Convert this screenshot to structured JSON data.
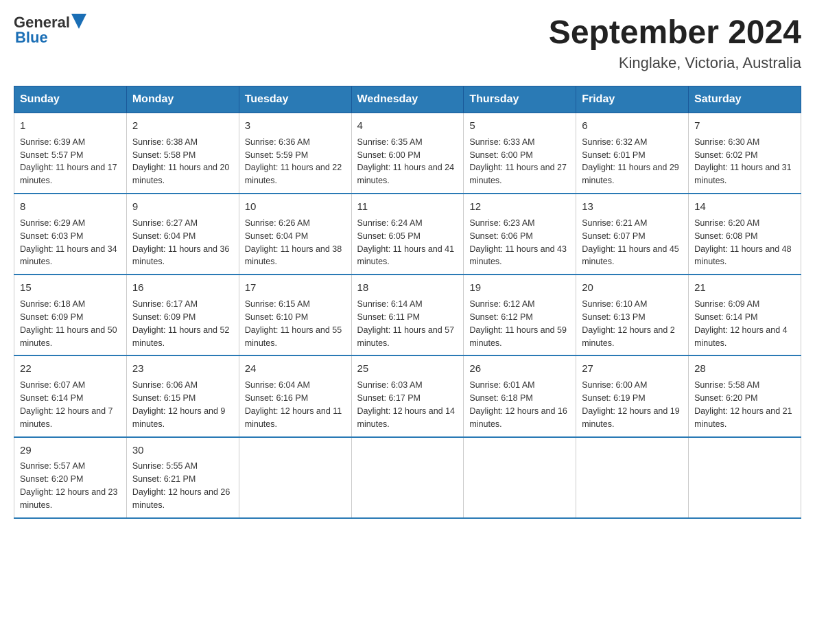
{
  "header": {
    "logo_text_general": "General",
    "logo_text_blue": "Blue",
    "main_title": "September 2024",
    "subtitle": "Kinglake, Victoria, Australia"
  },
  "days_of_week": [
    "Sunday",
    "Monday",
    "Tuesday",
    "Wednesday",
    "Thursday",
    "Friday",
    "Saturday"
  ],
  "weeks": [
    [
      {
        "day": "1",
        "sunrise": "6:39 AM",
        "sunset": "5:57 PM",
        "daylight": "11 hours and 17 minutes."
      },
      {
        "day": "2",
        "sunrise": "6:38 AM",
        "sunset": "5:58 PM",
        "daylight": "11 hours and 20 minutes."
      },
      {
        "day": "3",
        "sunrise": "6:36 AM",
        "sunset": "5:59 PM",
        "daylight": "11 hours and 22 minutes."
      },
      {
        "day": "4",
        "sunrise": "6:35 AM",
        "sunset": "6:00 PM",
        "daylight": "11 hours and 24 minutes."
      },
      {
        "day": "5",
        "sunrise": "6:33 AM",
        "sunset": "6:00 PM",
        "daylight": "11 hours and 27 minutes."
      },
      {
        "day": "6",
        "sunrise": "6:32 AM",
        "sunset": "6:01 PM",
        "daylight": "11 hours and 29 minutes."
      },
      {
        "day": "7",
        "sunrise": "6:30 AM",
        "sunset": "6:02 PM",
        "daylight": "11 hours and 31 minutes."
      }
    ],
    [
      {
        "day": "8",
        "sunrise": "6:29 AM",
        "sunset": "6:03 PM",
        "daylight": "11 hours and 34 minutes."
      },
      {
        "day": "9",
        "sunrise": "6:27 AM",
        "sunset": "6:04 PM",
        "daylight": "11 hours and 36 minutes."
      },
      {
        "day": "10",
        "sunrise": "6:26 AM",
        "sunset": "6:04 PM",
        "daylight": "11 hours and 38 minutes."
      },
      {
        "day": "11",
        "sunrise": "6:24 AM",
        "sunset": "6:05 PM",
        "daylight": "11 hours and 41 minutes."
      },
      {
        "day": "12",
        "sunrise": "6:23 AM",
        "sunset": "6:06 PM",
        "daylight": "11 hours and 43 minutes."
      },
      {
        "day": "13",
        "sunrise": "6:21 AM",
        "sunset": "6:07 PM",
        "daylight": "11 hours and 45 minutes."
      },
      {
        "day": "14",
        "sunrise": "6:20 AM",
        "sunset": "6:08 PM",
        "daylight": "11 hours and 48 minutes."
      }
    ],
    [
      {
        "day": "15",
        "sunrise": "6:18 AM",
        "sunset": "6:09 PM",
        "daylight": "11 hours and 50 minutes."
      },
      {
        "day": "16",
        "sunrise": "6:17 AM",
        "sunset": "6:09 PM",
        "daylight": "11 hours and 52 minutes."
      },
      {
        "day": "17",
        "sunrise": "6:15 AM",
        "sunset": "6:10 PM",
        "daylight": "11 hours and 55 minutes."
      },
      {
        "day": "18",
        "sunrise": "6:14 AM",
        "sunset": "6:11 PM",
        "daylight": "11 hours and 57 minutes."
      },
      {
        "day": "19",
        "sunrise": "6:12 AM",
        "sunset": "6:12 PM",
        "daylight": "11 hours and 59 minutes."
      },
      {
        "day": "20",
        "sunrise": "6:10 AM",
        "sunset": "6:13 PM",
        "daylight": "12 hours and 2 minutes."
      },
      {
        "day": "21",
        "sunrise": "6:09 AM",
        "sunset": "6:14 PM",
        "daylight": "12 hours and 4 minutes."
      }
    ],
    [
      {
        "day": "22",
        "sunrise": "6:07 AM",
        "sunset": "6:14 PM",
        "daylight": "12 hours and 7 minutes."
      },
      {
        "day": "23",
        "sunrise": "6:06 AM",
        "sunset": "6:15 PM",
        "daylight": "12 hours and 9 minutes."
      },
      {
        "day": "24",
        "sunrise": "6:04 AM",
        "sunset": "6:16 PM",
        "daylight": "12 hours and 11 minutes."
      },
      {
        "day": "25",
        "sunrise": "6:03 AM",
        "sunset": "6:17 PM",
        "daylight": "12 hours and 14 minutes."
      },
      {
        "day": "26",
        "sunrise": "6:01 AM",
        "sunset": "6:18 PM",
        "daylight": "12 hours and 16 minutes."
      },
      {
        "day": "27",
        "sunrise": "6:00 AM",
        "sunset": "6:19 PM",
        "daylight": "12 hours and 19 minutes."
      },
      {
        "day": "28",
        "sunrise": "5:58 AM",
        "sunset": "6:20 PM",
        "daylight": "12 hours and 21 minutes."
      }
    ],
    [
      {
        "day": "29",
        "sunrise": "5:57 AM",
        "sunset": "6:20 PM",
        "daylight": "12 hours and 23 minutes."
      },
      {
        "day": "30",
        "sunrise": "5:55 AM",
        "sunset": "6:21 PM",
        "daylight": "12 hours and 26 minutes."
      },
      null,
      null,
      null,
      null,
      null
    ]
  ],
  "labels": {
    "sunrise": "Sunrise:",
    "sunset": "Sunset:",
    "daylight": "Daylight:"
  }
}
